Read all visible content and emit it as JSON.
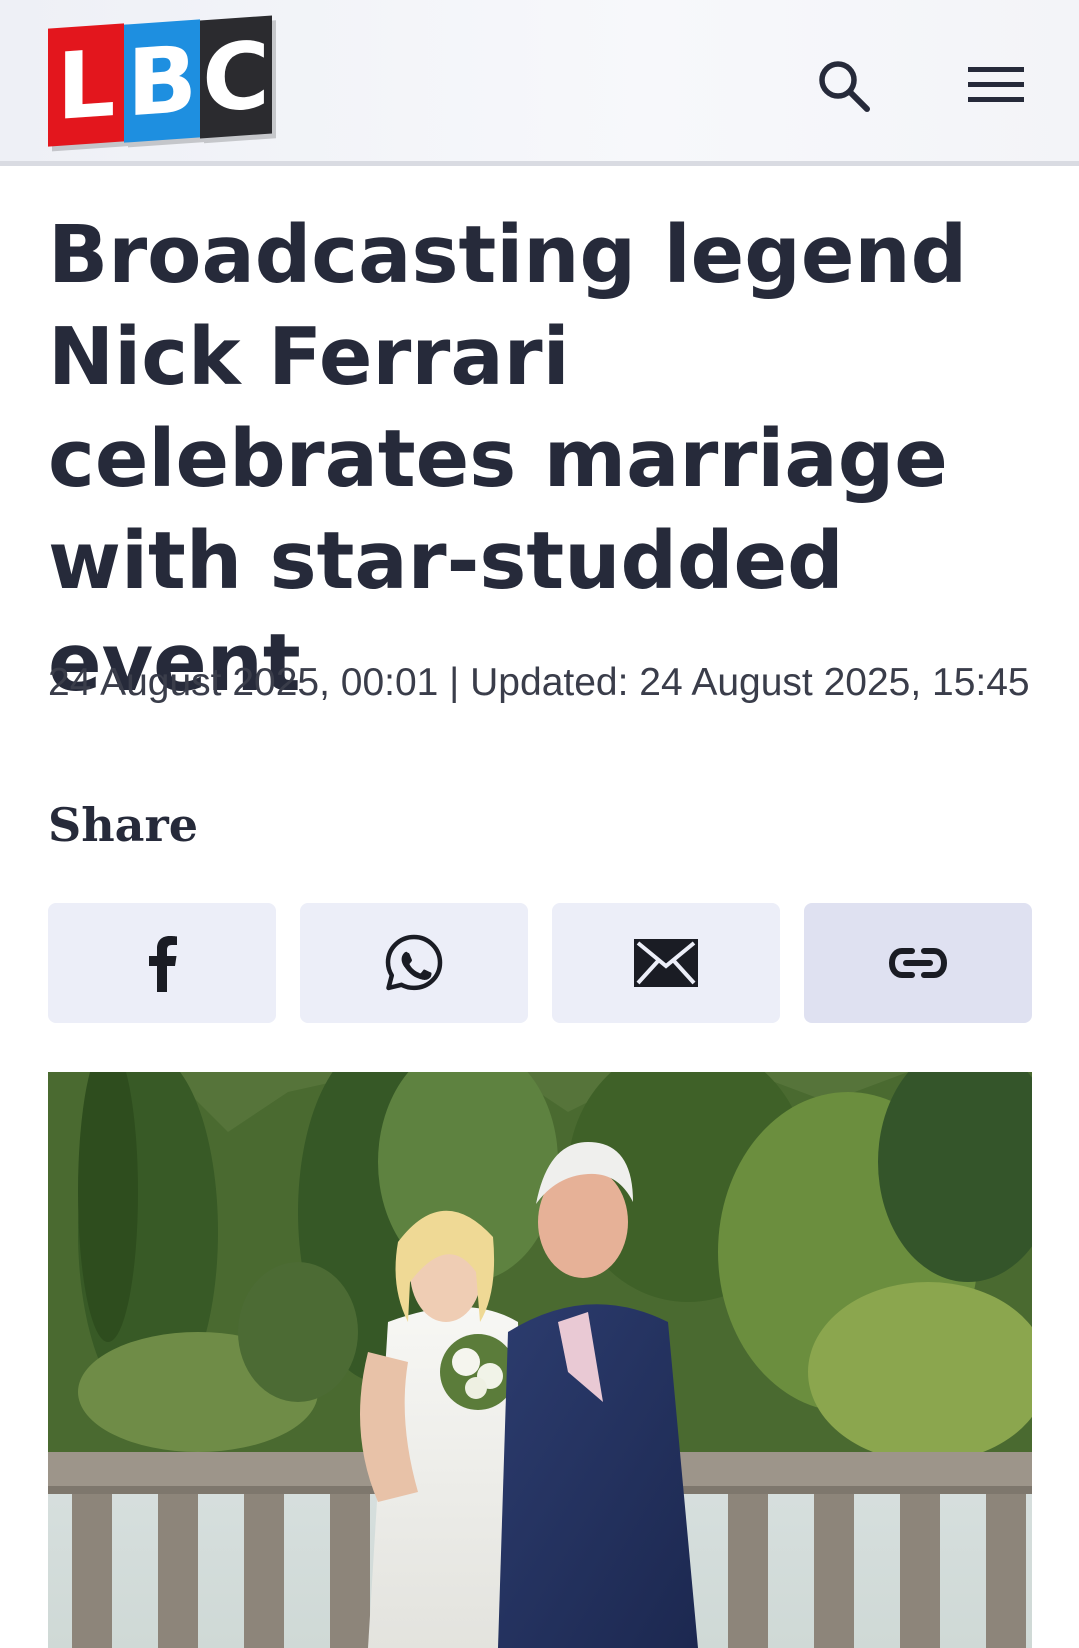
{
  "header": {
    "logo": {
      "letters": [
        "L",
        "B",
        "C"
      ],
      "colors": [
        "#e3161d",
        "#1e8fe0",
        "#2b2b2f"
      ]
    },
    "search_icon": "search-icon",
    "menu_icon": "hamburger-menu-icon"
  },
  "article": {
    "headline": "Broadcasting legend Nick Ferrari celebrates marriage with star-studded event",
    "dateline": "24 August 2025, 00:01 | Updated: 24 August 2025, 15:45",
    "share_label": "Share",
    "share_buttons": [
      {
        "icon": "facebook-icon"
      },
      {
        "icon": "whatsapp-icon"
      },
      {
        "icon": "email-icon"
      },
      {
        "icon": "copy-link-icon"
      }
    ]
  },
  "colors": {
    "text": "#262a3a",
    "share_bg": "#eceef8",
    "share_bg_active": "#dfe1f1"
  }
}
